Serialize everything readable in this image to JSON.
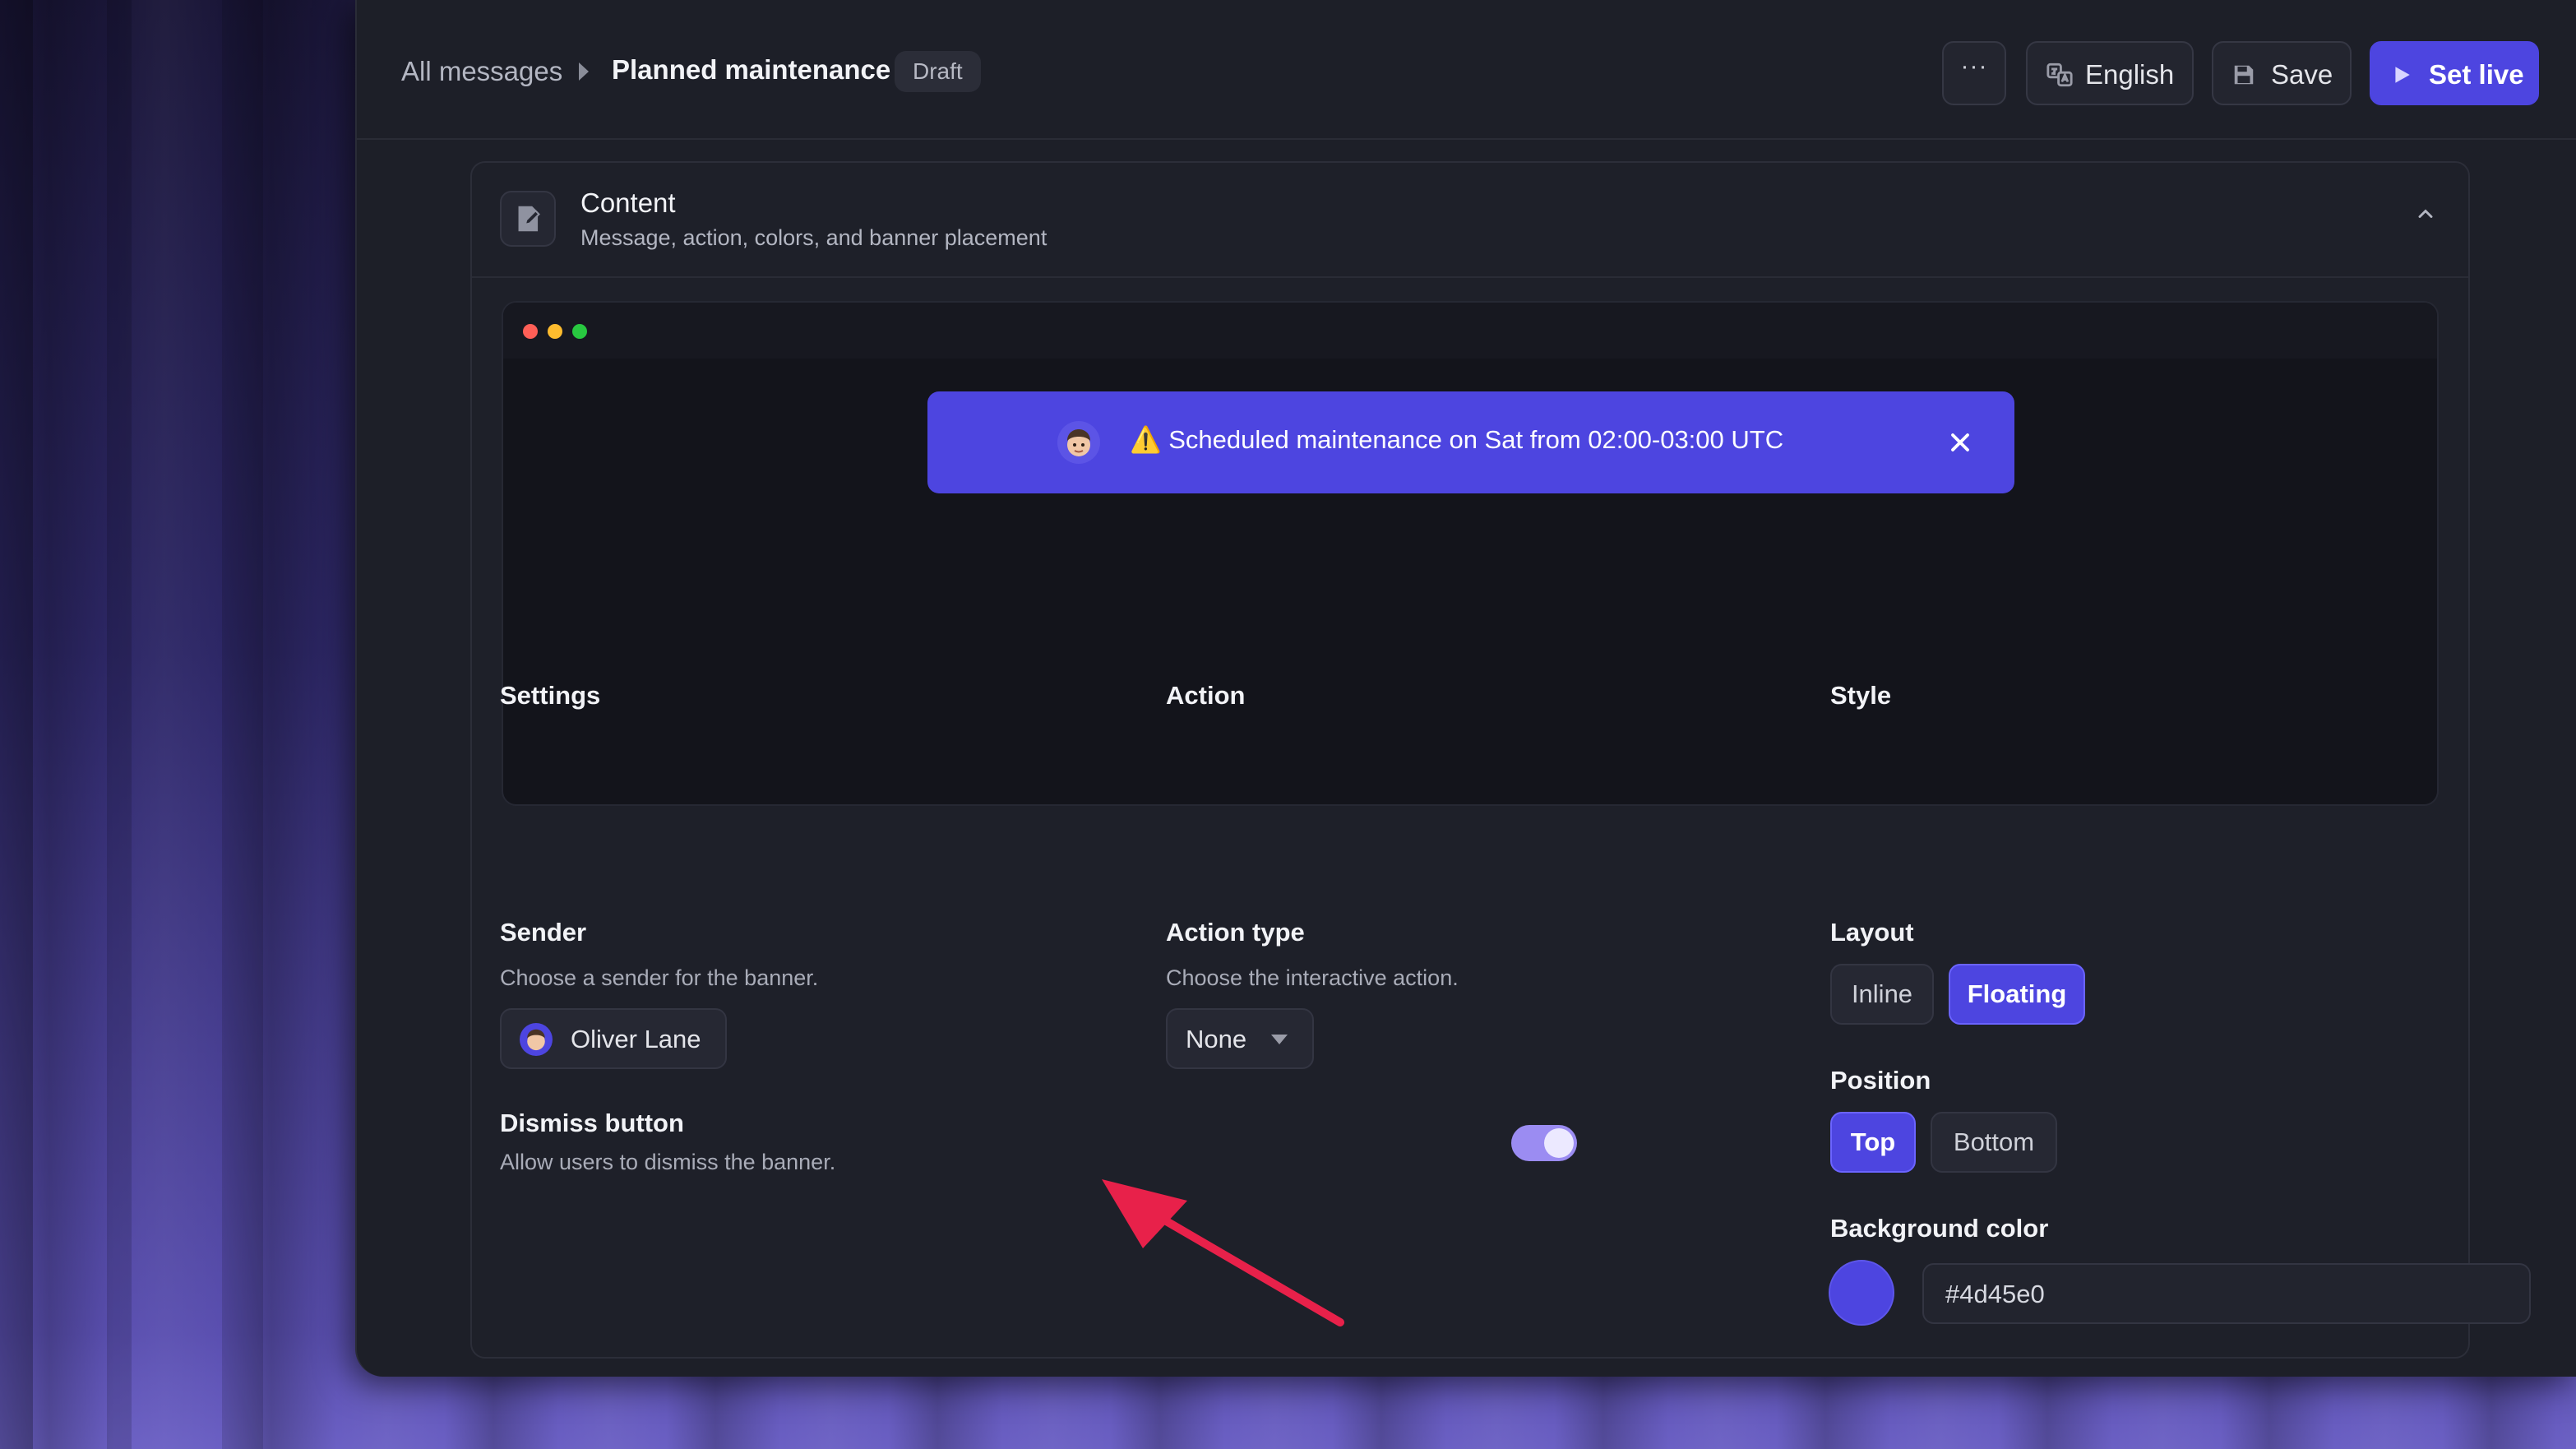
{
  "breadcrumb": {
    "root": "All messages",
    "current": "Planned maintenance",
    "status": "Draft"
  },
  "toolbar": {
    "more_label": "···",
    "language": "English",
    "save_label": "Save",
    "set_live_label": "Set live"
  },
  "section": {
    "title": "Content",
    "subtitle": "Message, action, colors, and banner placement"
  },
  "preview": {
    "banner_text": "⚠️ Scheduled maintenance on Sat from 02:00-03:00 UTC",
    "window_dots": [
      "#ff5f57",
      "#febc2e",
      "#28c840"
    ]
  },
  "settings": {
    "title": "Settings",
    "sender": {
      "label": "Sender",
      "help": "Choose a sender for the banner.",
      "value": "Oliver Lane"
    },
    "dismiss": {
      "label": "Dismiss button",
      "help": "Allow users to dismiss the banner.",
      "enabled": true
    }
  },
  "action": {
    "title": "Action",
    "type_label": "Action type",
    "help": "Choose the interactive action.",
    "value": "None"
  },
  "style": {
    "title": "Style",
    "layout": {
      "label": "Layout",
      "options": [
        "Inline",
        "Floating"
      ],
      "selected": "Floating"
    },
    "position": {
      "label": "Position",
      "options": [
        "Top",
        "Bottom"
      ],
      "selected": "Top"
    },
    "background": {
      "label": "Background color",
      "value": "#4d45e0"
    }
  },
  "colors": {
    "accent": "#4d45e0",
    "annotation_arrow": "#e8214a"
  }
}
